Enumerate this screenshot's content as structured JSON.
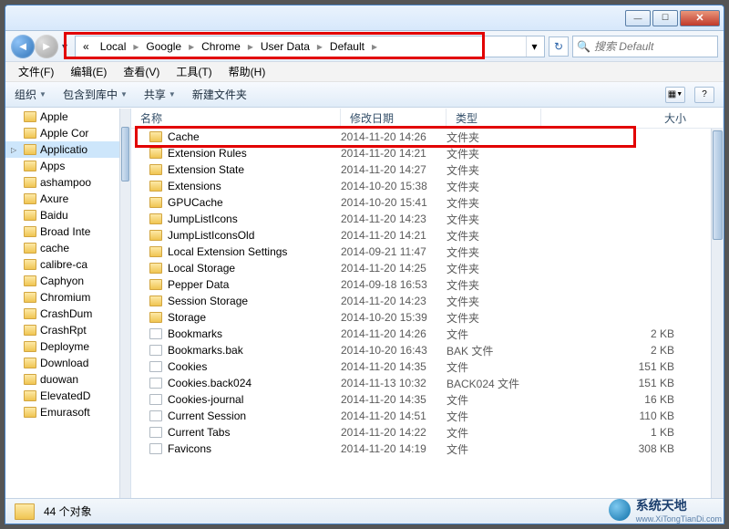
{
  "window_controls": {
    "min": "—",
    "max": "☐",
    "close": "✕"
  },
  "nav": {
    "back": "◄",
    "fwd": "►",
    "history_drop": "▾",
    "refresh": "↻"
  },
  "breadcrumb": {
    "leader": "«",
    "items": [
      "Local",
      "Google",
      "Chrome",
      "User Data",
      "Default"
    ],
    "sep": "▸"
  },
  "search": {
    "placeholder": "搜索 Default",
    "icon": "🔍"
  },
  "menu": [
    "文件(F)",
    "编辑(E)",
    "查看(V)",
    "工具(T)",
    "帮助(H)"
  ],
  "toolbar": {
    "organize": "组织",
    "include": "包含到库中",
    "share": "共享",
    "newfolder": "新建文件夹",
    "view_icon": "▦",
    "help_icon": "?"
  },
  "tree": [
    {
      "label": "Apple",
      "type": "folder"
    },
    {
      "label": "Apple Cor",
      "type": "folder"
    },
    {
      "label": "Applicatio",
      "type": "folder",
      "sel": true,
      "tri": true
    },
    {
      "label": "Apps",
      "type": "folder"
    },
    {
      "label": "ashampoo",
      "type": "folder"
    },
    {
      "label": "Axure",
      "type": "folder"
    },
    {
      "label": "Baidu",
      "type": "folder"
    },
    {
      "label": "Broad Inte",
      "type": "folder"
    },
    {
      "label": "cache",
      "type": "folder"
    },
    {
      "label": "calibre-ca",
      "type": "folder"
    },
    {
      "label": "Caphyon",
      "type": "folder"
    },
    {
      "label": "Chromium",
      "type": "folder"
    },
    {
      "label": "CrashDum",
      "type": "folder"
    },
    {
      "label": "CrashRpt",
      "type": "folder"
    },
    {
      "label": "Deployme",
      "type": "folder"
    },
    {
      "label": "Download",
      "type": "folder"
    },
    {
      "label": "duowan",
      "type": "folder"
    },
    {
      "label": "ElevatedD",
      "type": "folder"
    },
    {
      "label": "Emurasoft",
      "type": "folder"
    }
  ],
  "columns": {
    "name": "名称",
    "date": "修改日期",
    "type": "类型",
    "size": "大小"
  },
  "files": [
    {
      "name": "Cache",
      "date": "2014-11-20 14:26",
      "type": "文件夹",
      "size": "",
      "icon": "folder",
      "hl": true
    },
    {
      "name": "Extension Rules",
      "date": "2014-11-20 14:21",
      "type": "文件夹",
      "size": "",
      "icon": "folder"
    },
    {
      "name": "Extension State",
      "date": "2014-11-20 14:27",
      "type": "文件夹",
      "size": "",
      "icon": "folder"
    },
    {
      "name": "Extensions",
      "date": "2014-10-20 15:38",
      "type": "文件夹",
      "size": "",
      "icon": "folder"
    },
    {
      "name": "GPUCache",
      "date": "2014-10-20 15:41",
      "type": "文件夹",
      "size": "",
      "icon": "folder"
    },
    {
      "name": "JumpListIcons",
      "date": "2014-11-20 14:23",
      "type": "文件夹",
      "size": "",
      "icon": "folder"
    },
    {
      "name": "JumpListIconsOld",
      "date": "2014-11-20 14:21",
      "type": "文件夹",
      "size": "",
      "icon": "folder"
    },
    {
      "name": "Local Extension Settings",
      "date": "2014-09-21 11:47",
      "type": "文件夹",
      "size": "",
      "icon": "folder"
    },
    {
      "name": "Local Storage",
      "date": "2014-11-20 14:25",
      "type": "文件夹",
      "size": "",
      "icon": "folder"
    },
    {
      "name": "Pepper Data",
      "date": "2014-09-18 16:53",
      "type": "文件夹",
      "size": "",
      "icon": "folder"
    },
    {
      "name": "Session Storage",
      "date": "2014-11-20 14:23",
      "type": "文件夹",
      "size": "",
      "icon": "folder"
    },
    {
      "name": "Storage",
      "date": "2014-10-20 15:39",
      "type": "文件夹",
      "size": "",
      "icon": "folder"
    },
    {
      "name": "Bookmarks",
      "date": "2014-11-20 14:26",
      "type": "文件",
      "size": "2 KB",
      "icon": "file"
    },
    {
      "name": "Bookmarks.bak",
      "date": "2014-10-20 16:43",
      "type": "BAK 文件",
      "size": "2 KB",
      "icon": "file"
    },
    {
      "name": "Cookies",
      "date": "2014-11-20 14:35",
      "type": "文件",
      "size": "151 KB",
      "icon": "file"
    },
    {
      "name": "Cookies.back024",
      "date": "2014-11-13 10:32",
      "type": "BACK024 文件",
      "size": "151 KB",
      "icon": "file"
    },
    {
      "name": "Cookies-journal",
      "date": "2014-11-20 14:35",
      "type": "文件",
      "size": "16 KB",
      "icon": "file"
    },
    {
      "name": "Current Session",
      "date": "2014-11-20 14:51",
      "type": "文件",
      "size": "110 KB",
      "icon": "file"
    },
    {
      "name": "Current Tabs",
      "date": "2014-11-20 14:22",
      "type": "文件",
      "size": "1 KB",
      "icon": "file"
    },
    {
      "name": "Favicons",
      "date": "2014-11-20 14:19",
      "type": "文件",
      "size": "308 KB",
      "icon": "file"
    }
  ],
  "status": {
    "count": "44 个对象"
  },
  "watermark": {
    "title": "系统天地",
    "url": "www.XiTongTianDi.com"
  }
}
